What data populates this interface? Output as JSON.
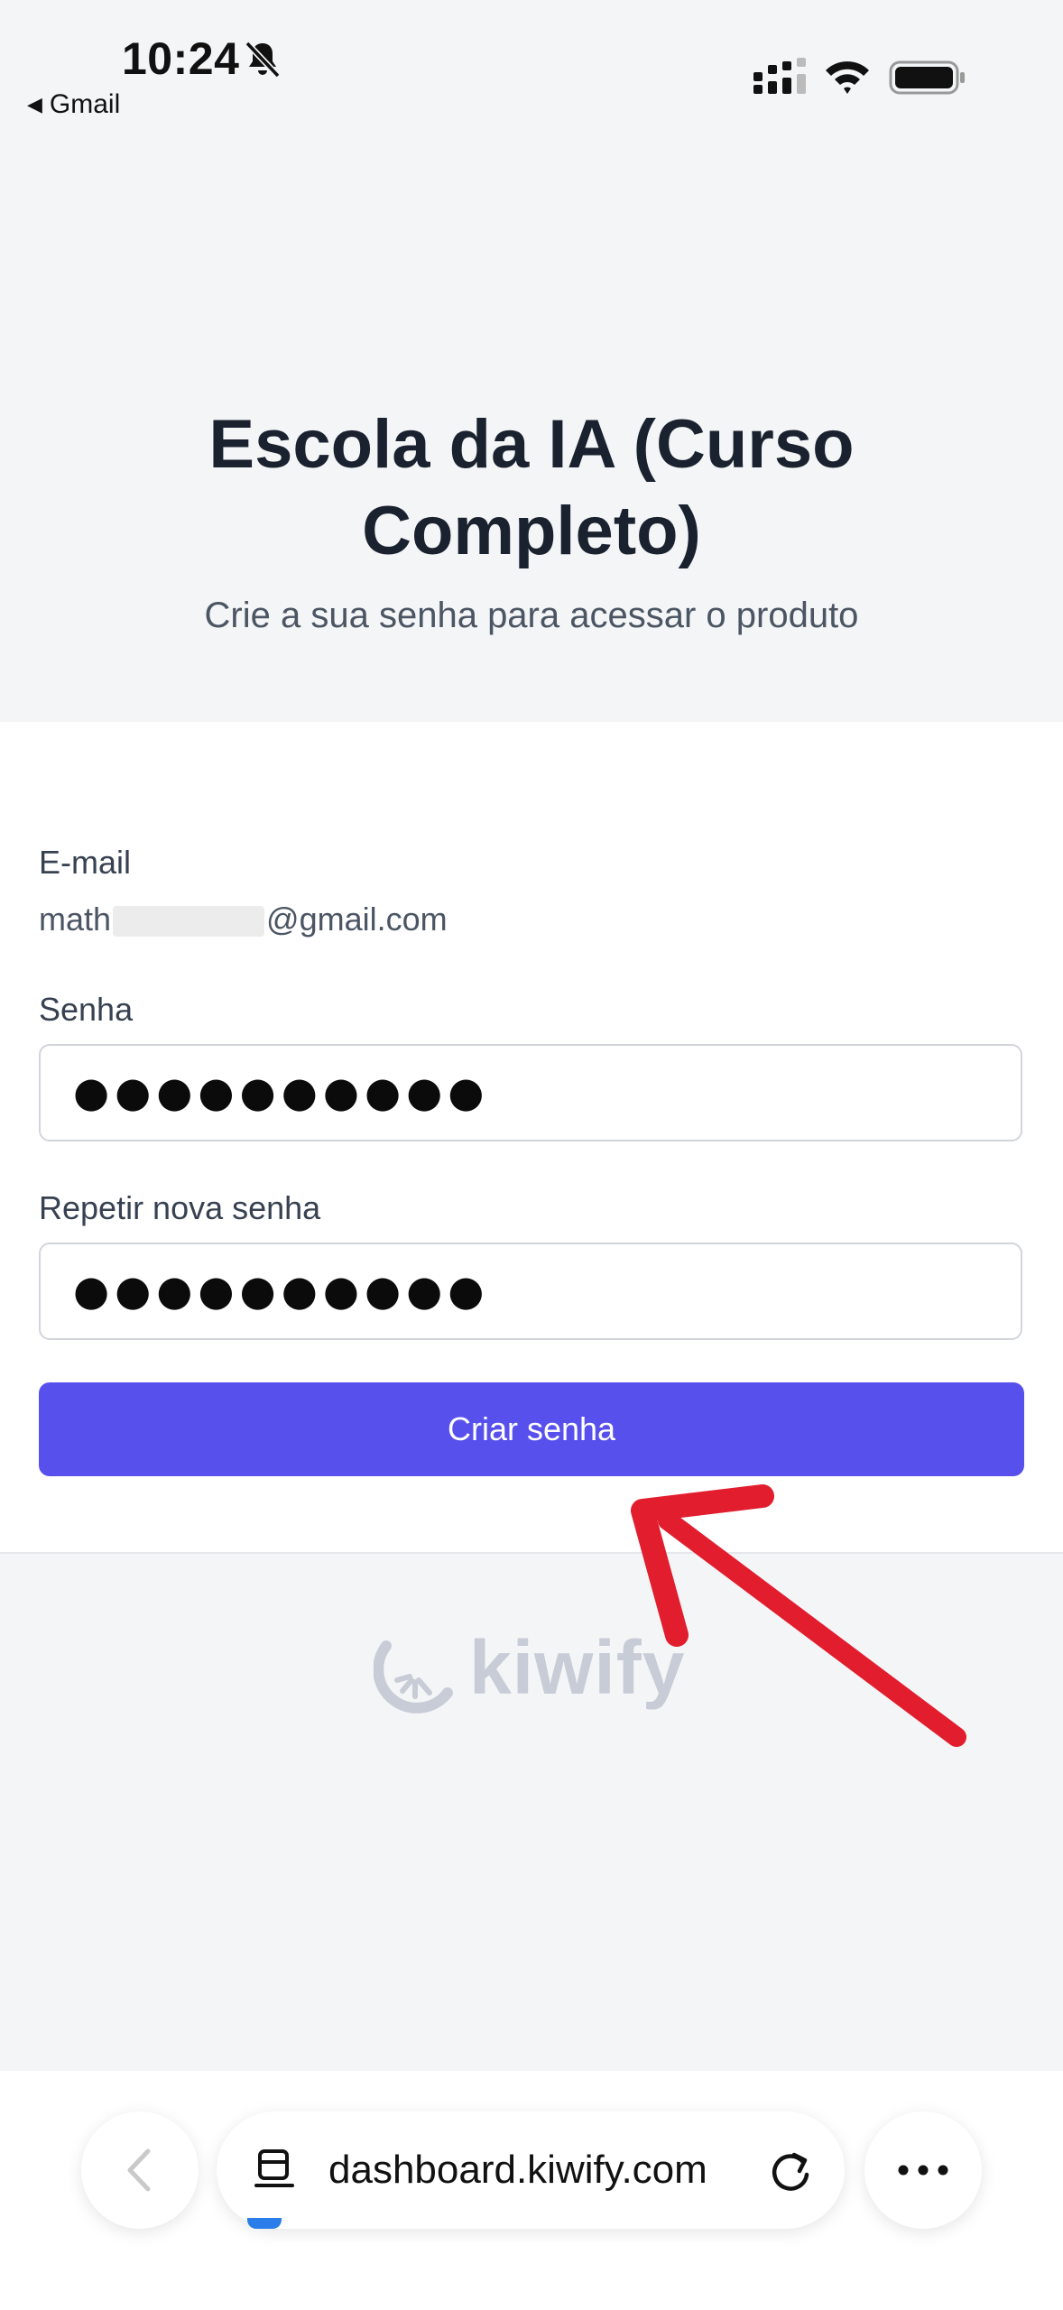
{
  "status_bar": {
    "time": "10:24",
    "back_app": "Gmail",
    "icons": [
      "bell-slash-icon",
      "signal-icon",
      "wifi-icon",
      "battery-icon"
    ]
  },
  "header": {
    "title_line1": "Escola da IA (Curso",
    "title_line2": "Completo)",
    "subtitle": "Crie a sua senha para acessar o produto"
  },
  "form": {
    "email_label": "E-mail",
    "email_prefix": "math",
    "email_suffix": "@gmail.com",
    "password_label": "Senha",
    "password_value": "●●●●●●●●●●",
    "repeat_label": "Repetir nova senha",
    "repeat_value": "●●●●●●●●●●",
    "submit_label": "Criar senha"
  },
  "footer": {
    "logo_text": "kiwify"
  },
  "browser": {
    "url": "dashboard.kiwify.com"
  },
  "colors": {
    "button": "#5850ec",
    "arrow": "#e11d2e",
    "logo": "#c7ccd6"
  }
}
